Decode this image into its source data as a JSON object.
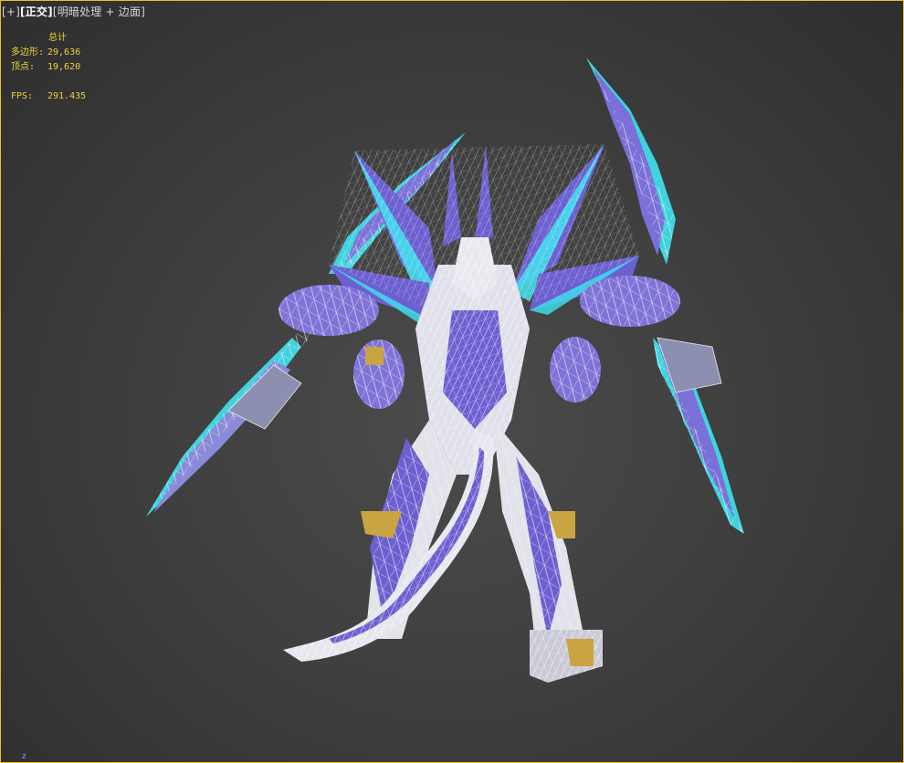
{
  "viewport": {
    "label_plus": "[+]",
    "label_view": "[正交]",
    "label_shading": "[明暗处理 + 边面]"
  },
  "stats": {
    "header": "总计",
    "polys_label": "多边形:",
    "polys_value": "29,636",
    "verts_label": "顶点:",
    "verts_value": "19,620",
    "fps_label": "FPS:",
    "fps_value": "291.435"
  },
  "axis_label": "z",
  "colors": {
    "border": "#f0c020",
    "stats_text": "#f2d237",
    "model_purple": "#6c5fd0",
    "model_cyan": "#3fe3f0",
    "model_white": "#e8e8ef",
    "model_gold": "#c9a440"
  },
  "icons": [
    "wireframe-model"
  ]
}
